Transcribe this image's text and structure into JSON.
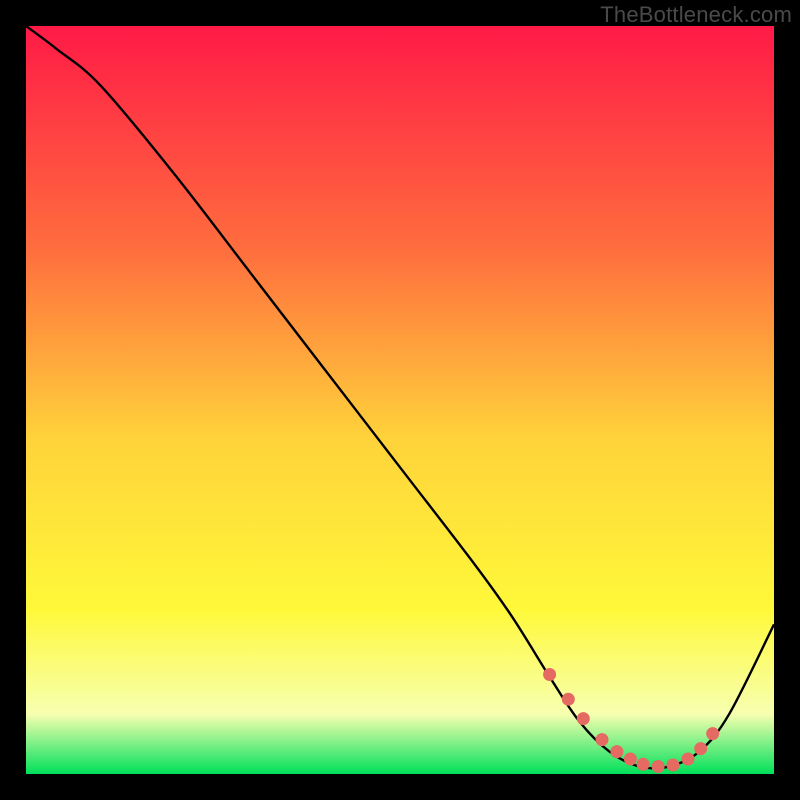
{
  "watermark": "TheBottleneck.com",
  "colors": {
    "gradient_top": "#ff1a46",
    "gradient_mid_upper": "#ff6e3e",
    "gradient_mid": "#ffd23a",
    "gradient_mid_lower": "#fff93a",
    "gradient_low": "#f7ffb0",
    "gradient_bottom": "#00e05a",
    "curve": "#000000",
    "marker": "#e46a62",
    "background": "#000000"
  },
  "chart_data": {
    "type": "line",
    "title": "",
    "xlabel": "",
    "ylabel": "",
    "xlim": [
      0,
      100
    ],
    "ylim": [
      0,
      100
    ],
    "grid": false,
    "legend": false,
    "series": [
      {
        "name": "bottleneck-curve",
        "x": [
          0,
          4,
          10,
          20,
          30,
          40,
          50,
          60,
          65,
          70,
          74,
          78,
          82,
          86,
          90,
          94,
          100
        ],
        "y": [
          100,
          97,
          92,
          80,
          67,
          54,
          41,
          28,
          21,
          13,
          7,
          3,
          1,
          1,
          3,
          8,
          20
        ]
      }
    ],
    "markers": {
      "name": "optimal-range-dots",
      "x": [
        70.0,
        72.5,
        74.5,
        77.0,
        79.0,
        80.8,
        82.5,
        84.5,
        86.5,
        88.5,
        90.2,
        91.8
      ],
      "y": [
        13.3,
        10.0,
        7.4,
        4.6,
        3.0,
        2.0,
        1.3,
        1.0,
        1.2,
        2.0,
        3.4,
        5.4
      ]
    }
  }
}
